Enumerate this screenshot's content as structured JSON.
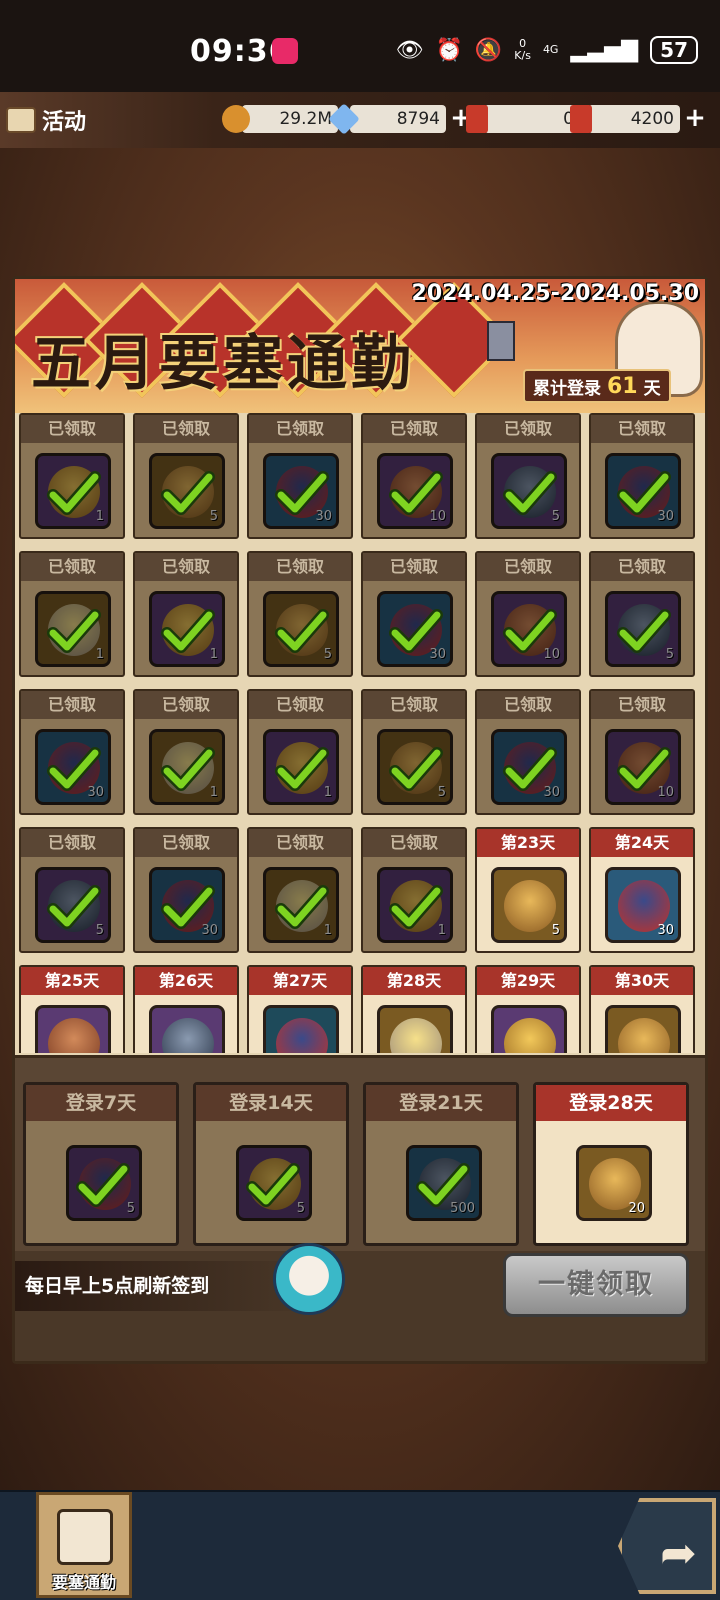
{
  "status_bar": {
    "time": "09:36",
    "net_speed_value": "0",
    "net_speed_unit": "K/s",
    "network": "4G",
    "battery": "57"
  },
  "top_bar": {
    "title": "活动",
    "resources": [
      {
        "name": "gold-coin",
        "value": "29.2M",
        "has_plus": false,
        "color": "#d9902e"
      },
      {
        "name": "crystal",
        "value": "8794",
        "has_plus": true,
        "color": "#7fb6ef"
      },
      {
        "name": "ticket-dai",
        "value": "0",
        "has_plus": false,
        "color": "#c83a2a"
      },
      {
        "name": "ticket-dian",
        "value": "4200",
        "has_plus": true,
        "color": "#c83a2a"
      }
    ]
  },
  "banner": {
    "title": "五月要塞通勤",
    "date_range": "2024.04.25-2024.05.30",
    "login_label": "累计登录",
    "login_days": "61",
    "login_unit": "天"
  },
  "days": [
    {
      "label": "已领取",
      "claimed": true,
      "icon": "coins",
      "qty": "1",
      "bg": "purple"
    },
    {
      "label": "已领取",
      "claimed": true,
      "icon": "pot",
      "qty": "5",
      "bg": "gold"
    },
    {
      "label": "已领取",
      "claimed": true,
      "icon": "fruit",
      "qty": "30",
      "bg": "blue"
    },
    {
      "label": "已领取",
      "claimed": true,
      "icon": "meat",
      "qty": "10",
      "bg": "purple"
    },
    {
      "label": "已领取",
      "claimed": true,
      "icon": "ore",
      "qty": "5",
      "bg": "purple"
    },
    {
      "label": "已领取",
      "claimed": true,
      "icon": "fruit",
      "qty": "30",
      "bg": "blue"
    },
    {
      "label": "已领取",
      "claimed": true,
      "icon": "angel",
      "qty": "1",
      "bg": "gold"
    },
    {
      "label": "已领取",
      "claimed": true,
      "icon": "coins",
      "qty": "1",
      "bg": "purple"
    },
    {
      "label": "已领取",
      "claimed": true,
      "icon": "pot",
      "qty": "5",
      "bg": "gold"
    },
    {
      "label": "已领取",
      "claimed": true,
      "icon": "fruit",
      "qty": "30",
      "bg": "blue"
    },
    {
      "label": "已领取",
      "claimed": true,
      "icon": "meat",
      "qty": "10",
      "bg": "purple"
    },
    {
      "label": "已领取",
      "claimed": true,
      "icon": "ore",
      "qty": "5",
      "bg": "purple"
    },
    {
      "label": "已领取",
      "claimed": true,
      "icon": "fruit",
      "qty": "30",
      "bg": "blue"
    },
    {
      "label": "已领取",
      "claimed": true,
      "icon": "angel",
      "qty": "1",
      "bg": "gold"
    },
    {
      "label": "已领取",
      "claimed": true,
      "icon": "coins",
      "qty": "1",
      "bg": "purple"
    },
    {
      "label": "已领取",
      "claimed": true,
      "icon": "pot",
      "qty": "5",
      "bg": "gold"
    },
    {
      "label": "已领取",
      "claimed": true,
      "icon": "fruit",
      "qty": "30",
      "bg": "blue"
    },
    {
      "label": "已领取",
      "claimed": true,
      "icon": "meat",
      "qty": "10",
      "bg": "purple"
    },
    {
      "label": "已领取",
      "claimed": true,
      "icon": "ore",
      "qty": "5",
      "bg": "purple"
    },
    {
      "label": "已领取",
      "claimed": true,
      "icon": "fruit",
      "qty": "30",
      "bg": "blue"
    },
    {
      "label": "已领取",
      "claimed": true,
      "icon": "angel",
      "qty": "1",
      "bg": "gold"
    },
    {
      "label": "已领取",
      "claimed": true,
      "icon": "coins",
      "qty": "1",
      "bg": "purple"
    },
    {
      "label": "第23天",
      "claimed": false,
      "icon": "pot",
      "qty": "5",
      "bg": "gold"
    },
    {
      "label": "第24天",
      "claimed": false,
      "icon": "fruit",
      "qty": "30",
      "bg": "blue"
    },
    {
      "label": "第25天",
      "claimed": false,
      "icon": "meat",
      "qty": "",
      "bg": "purple"
    },
    {
      "label": "第26天",
      "claimed": false,
      "icon": "ore",
      "qty": "",
      "bg": "purple"
    },
    {
      "label": "第27天",
      "claimed": false,
      "icon": "fruit",
      "qty": "",
      "bg": "teal"
    },
    {
      "label": "第28天",
      "claimed": false,
      "icon": "angel",
      "qty": "",
      "bg": "gold"
    },
    {
      "label": "第29天",
      "claimed": false,
      "icon": "coins",
      "qty": "",
      "bg": "purple"
    },
    {
      "label": "第30天",
      "claimed": false,
      "icon": "pot",
      "qty": "",
      "bg": "gold"
    }
  ],
  "milestones": [
    {
      "label": "登录7天",
      "claimed": true,
      "icon": "fruit",
      "qty": "5",
      "bg": "purple"
    },
    {
      "label": "登录14天",
      "claimed": true,
      "icon": "coins",
      "qty": "5",
      "bg": "purple"
    },
    {
      "label": "登录21天",
      "claimed": true,
      "icon": "ore",
      "qty": "500",
      "bg": "blue"
    },
    {
      "label": "登录28天",
      "claimed": false,
      "icon": "pot",
      "qty": "20",
      "bg": "gold"
    }
  ],
  "footer": {
    "refresh_note": "每日早上5点刷新签到",
    "claim_all": "一键领取"
  },
  "bottom_bar": {
    "tab_label": "要塞通勤"
  },
  "colors": {
    "claimed_header": "#5a4634",
    "open_header": "#a8342a",
    "check": "#7ed321",
    "accent_gold": "#ffd85a"
  }
}
